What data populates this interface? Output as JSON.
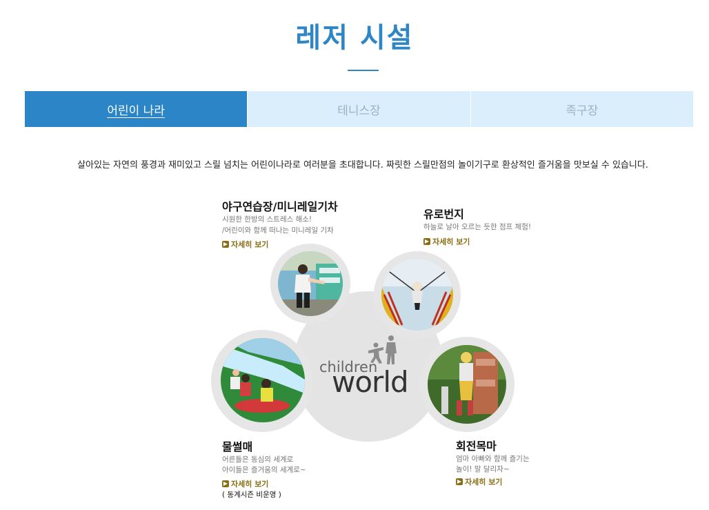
{
  "page": {
    "title": "레저 시설"
  },
  "tabs": [
    {
      "label": "어린이 나라",
      "active": true
    },
    {
      "label": "테니스장",
      "active": false
    },
    {
      "label": "족구장",
      "active": false
    }
  ],
  "intro": "살아있는 자연의 풍경과 재미있고 스릴 넘치는 어린이나라로 여러분을 초대합니다. 짜릿한 스릴만점의 놀이기구로 환상적인 즐거움을 맛보실 수 있습니다.",
  "center_logo": {
    "small": "children",
    "big": "world"
  },
  "attractions": {
    "baseball": {
      "title": "야구연습장/미니레일기차",
      "desc1": "시원한 한방의 스트레스 해소!",
      "desc2": "/어린이와 함께 떠나는 미니레일 기차",
      "more": "자세히 보기"
    },
    "bungee": {
      "title": "유로번지",
      "desc1": "하늘로 날아 오르는 듯한 점프 체험!",
      "more": "자세히 보기"
    },
    "sled": {
      "title": "물썰매",
      "desc1": "어른들은 동심의 세계로",
      "desc2": "아이들은 즐거움의 세계로~",
      "more": "자세히 보기",
      "note": "( 동계시즌 비운영 )"
    },
    "carousel": {
      "title": "회전목마",
      "desc1": "엄마 아빠와 함께 즐기는",
      "desc2": "놀이! 말 달리자~",
      "more": "자세히 보기"
    }
  },
  "colors": {
    "accent": "#2e86c7",
    "tab_active": "#2b85c7",
    "tab_inactive": "#dbeefb",
    "link": "#8a6d12"
  }
}
